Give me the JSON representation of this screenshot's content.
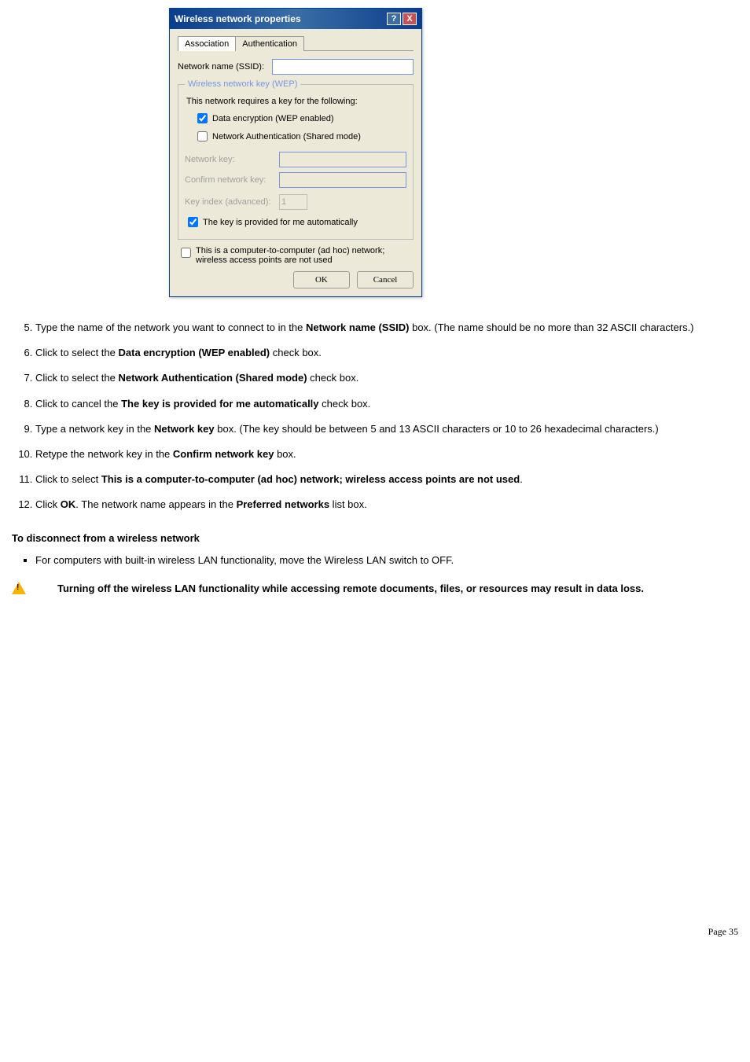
{
  "dialog": {
    "title": "Wireless network properties",
    "tabs": [
      "Association",
      "Authentication"
    ],
    "active_tab": 0,
    "ssid_label": "Network name (SSID):",
    "ssid_value": "",
    "wep_group": "Wireless network key (WEP)",
    "wep_intro": "This network requires a key for the following:",
    "chk_data_encryption": "Data encryption (WEP enabled)",
    "chk_network_auth": "Network Authentication (Shared mode)",
    "network_key_label": "Network key:",
    "confirm_key_label": "Confirm network key:",
    "key_index_label": "Key index (advanced):",
    "key_index_value": "1",
    "chk_auto_key": "The key is provided for me automatically",
    "chk_adhoc": "This is a computer-to-computer (ad hoc) network; wireless access points are not used",
    "btn_ok": "OK",
    "btn_cancel": "Cancel"
  },
  "steps": [
    {
      "n": "5.",
      "pre": "Type the name of the network you want to connect to in the ",
      "bold": "Network name (SSID)",
      "post": " box. (The name should be no more than 32 ASCII characters.)"
    },
    {
      "n": "6.",
      "pre": "Click to select the ",
      "bold": "Data encryption (WEP enabled)",
      "post": " check box."
    },
    {
      "n": "7.",
      "pre": "Click to select the ",
      "bold": "Network Authentication (Shared mode)",
      "post": " check box."
    },
    {
      "n": "8.",
      "pre": "Click to cancel the ",
      "bold": "The key is provided for me automatically",
      "post": " check box."
    },
    {
      "n": "9.",
      "pre": "Type a network key in the ",
      "bold": "Network key",
      "post": " box. (The key should be between 5 and 13 ASCII characters or 10 to 26 hexadecimal characters.)"
    },
    {
      "n": "10.",
      "pre": "Retype the network key in the ",
      "bold": "Confirm network key",
      "post": " box."
    },
    {
      "n": "11.",
      "pre": "Click to select ",
      "bold": "This is a computer-to-computer (ad hoc) network; wireless access points are not used",
      "post": "."
    },
    {
      "n": "12.",
      "pre": "Click ",
      "bold": "OK",
      "post": ". The network name appears in the ",
      "bold2": "Preferred networks",
      "post2": " list box."
    }
  ],
  "disconnect_heading": "To disconnect from a wireless network",
  "disconnect_bullet": "For computers with built-in wireless LAN functionality, move the Wireless LAN switch to OFF.",
  "warning_text": "Turning off the wireless LAN functionality while accessing remote documents, files, or resources may result in data loss.",
  "page_number": "Page 35"
}
